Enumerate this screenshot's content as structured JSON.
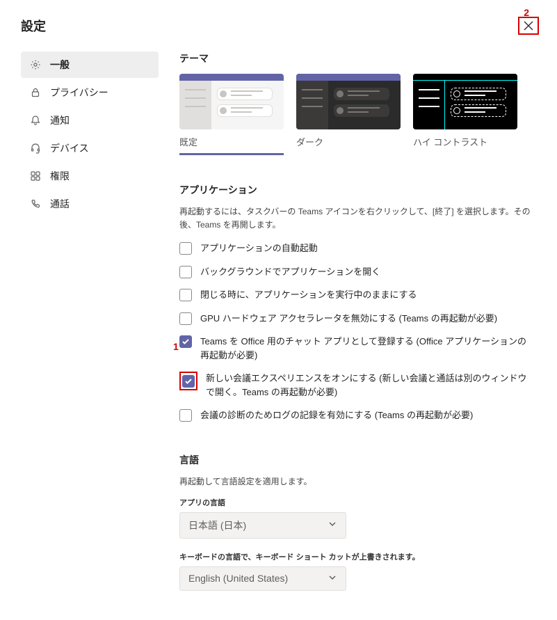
{
  "dialog": {
    "title": "設定"
  },
  "sidebar": {
    "items": [
      {
        "label": "一般"
      },
      {
        "label": "プライバシー"
      },
      {
        "label": "通知"
      },
      {
        "label": "デバイス"
      },
      {
        "label": "権限"
      },
      {
        "label": "通話"
      }
    ]
  },
  "theme": {
    "title": "テーマ",
    "options": [
      {
        "label": "既定"
      },
      {
        "label": "ダーク"
      },
      {
        "label": "ハイ コントラスト"
      }
    ]
  },
  "application": {
    "title": "アプリケーション",
    "description": "再起動するには、タスクバーの Teams アイコンを右クリックして、[終了] を選択します。その後、Teams を再開します。",
    "checkboxes": [
      {
        "label": "アプリケーションの自動起動",
        "checked": false
      },
      {
        "label": "バックグラウンドでアプリケーションを開く",
        "checked": false
      },
      {
        "label": "閉じる時に、アプリケーションを実行中のままにする",
        "checked": false
      },
      {
        "label": "GPU ハードウェア アクセラレータを無効にする (Teams の再起動が必要)",
        "checked": false
      },
      {
        "label": "Teams を Office 用のチャット アプリとして登録する (Office アプリケーションの再起動が必要)",
        "checked": true
      },
      {
        "label": "新しい会議エクスペリエンスをオンにする (新しい会議と通話は別のウィンドウで開く。Teams の再起動が必要)",
        "checked": true
      },
      {
        "label": "会議の診断のためログの記録を有効にする (Teams の再起動が必要)",
        "checked": false
      }
    ]
  },
  "language": {
    "title": "言語",
    "description": "再起動して言語設定を適用します。",
    "app_lang_label": "アプリの言語",
    "app_lang_value": "日本語 (日本)",
    "kb_desc": "キーボードの言語で、キーボード ショート カットが上書きされます。",
    "kb_lang_value": "English (United States)"
  },
  "annotations": {
    "one": "1",
    "two": "2"
  }
}
